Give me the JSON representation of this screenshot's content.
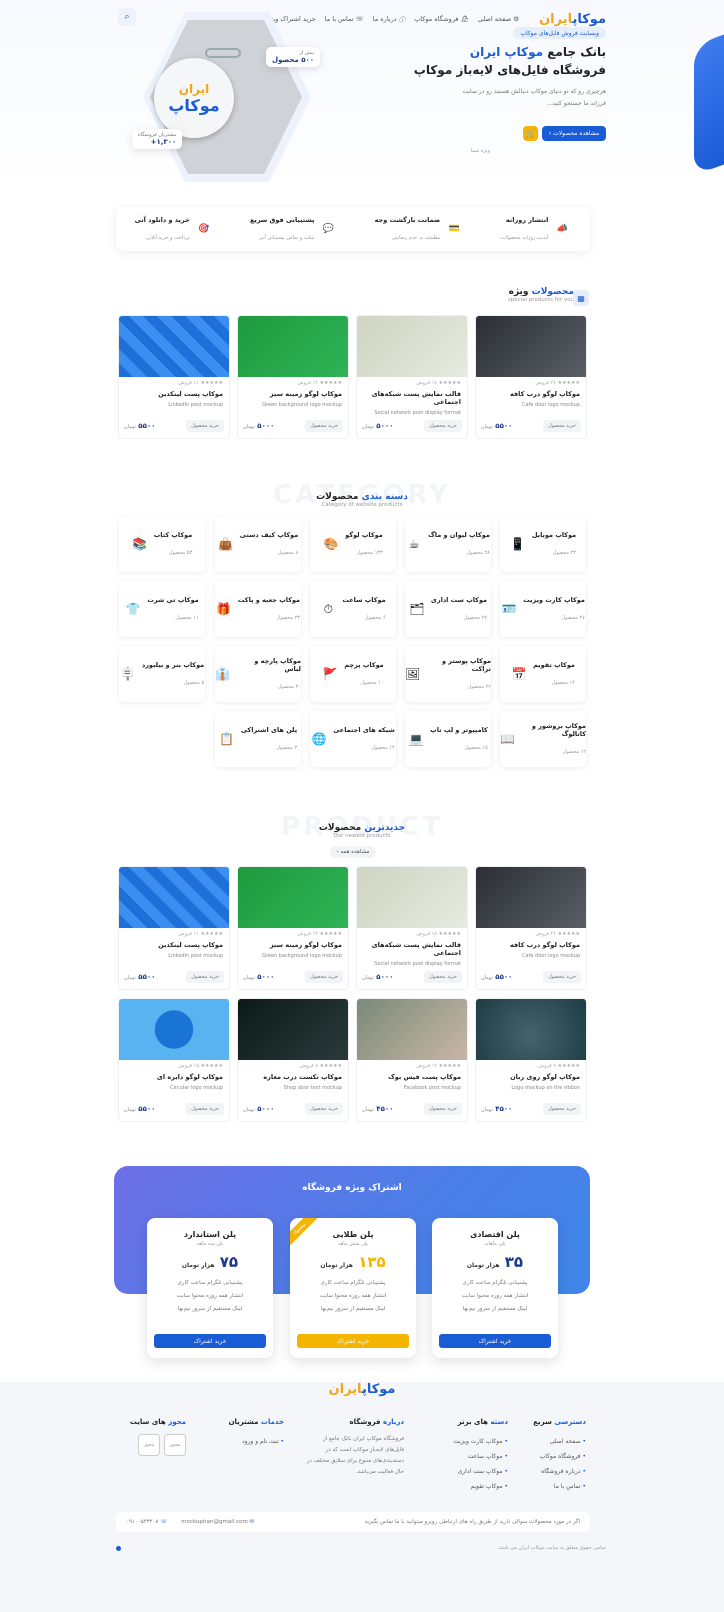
{
  "header": {
    "logo_main": "موکاپ",
    "logo_accent": "ایران",
    "nav": [
      "صفحه اصلی",
      "فروشگاه موکاپ",
      "درباره ما",
      "تماس با ما",
      "خرید اشتراک ویژه"
    ]
  },
  "hero": {
    "tag": "وبسایت فروش فایل‌های موکاپ",
    "title_line1_prefix": "بانک جامع",
    "title_line1_brand": "موکاپ ایران",
    "title_line2": "فروشگاه فایل‌های لایه‌باز موکاپ",
    "desc": "هرچیزی رو که تو دنیای موکاپ دنبالش هستید رو در سایت فرزاند ما جستجو کنید...",
    "cta": "مشاهده محصولات",
    "note": "ویژه شما",
    "stat1_label": "بیش از",
    "stat1_value": "۵۰۰ محصول",
    "stat2_label": "مشتریان فروشگاه",
    "stat2_value": "۱,۳۰۰+",
    "badge_top": "ایران",
    "badge_main": "موکاپ"
  },
  "features": [
    {
      "title": "انتشار روزانه",
      "sub": "آپدیت روزانه محصولات",
      "icon": "megaphone-icon",
      "glyph": "📣"
    },
    {
      "title": "ضمانت بازگشت وجه",
      "sub": "مطمئنه به عدم رضایتی",
      "icon": "card-icon",
      "glyph": "💳"
    },
    {
      "title": "پشتیبانی فوق سریع",
      "sub": "تیکت و تماس پشتیبانی آنی",
      "icon": "chat-icon",
      "glyph": "💬"
    },
    {
      "title": "خرید و دانلود آنی",
      "sub": "پرداخت و خرید آنلاین",
      "icon": "target-icon",
      "glyph": "🎯"
    }
  ],
  "special": {
    "title_a": "محصولات",
    "title_b": "ویژه",
    "sub": "special products for you",
    "products": [
      {
        "name": "موکاپ لوگو درب کافه",
        "en": "Cafe door logo mockup",
        "price": "۵۵۰۰",
        "rating": "★★★★★ ۲۶ فروش"
      },
      {
        "name": "قالب نمایش پست شبکه‌های اجتماعی",
        "en": "Social network post display format",
        "price": "۵۰۰۰",
        "rating": "★★★★★ ۱۸ فروش"
      },
      {
        "name": "موکاپ لوگو زمینه سبز",
        "en": "Green background logo mockup",
        "price": "۵۰۰۰",
        "rating": "★★★★★ ۱۴ فروش"
      },
      {
        "name": "موکاپ پست لینکدین",
        "en": "LinkedIn post mockup",
        "price": "۵۵۰۰",
        "rating": "★★★★★ ۱۱ فروش"
      }
    ]
  },
  "category": {
    "ghost": "CATEGORY",
    "title_a": "دسته بندی",
    "title_b": "محصولات",
    "sub": "Category of website products",
    "items": [
      {
        "name": "موکاپ موبایل",
        "count": "۳۴ محصول",
        "glyph": "📱",
        "icon": "mobile-icon"
      },
      {
        "name": "موکاپ لیوان و ماگ",
        "count": "۲۸ محصول",
        "glyph": "☕",
        "icon": "mug-icon"
      },
      {
        "name": "موکاپ لوگو",
        "count": "۱۳۳ محصول",
        "glyph": "🎨",
        "icon": "logo-icon"
      },
      {
        "name": "موکاپ کیف دستی",
        "count": "۸ محصول",
        "glyph": "👜",
        "icon": "bag-icon"
      },
      {
        "name": "موکاپ کتاب",
        "count": "۵۳ محصول",
        "glyph": "📚",
        "icon": "book-icon"
      },
      {
        "name": "موکاپ کارت ویزیت",
        "count": "۴۷ محصول",
        "glyph": "🪪",
        "icon": "card-icon"
      },
      {
        "name": "موکاپ ست اداری",
        "count": "۲۷ محصول",
        "glyph": "🗂",
        "icon": "office-icon"
      },
      {
        "name": "موکاپ ساعت",
        "count": "۶ محصول",
        "glyph": "⏱",
        "icon": "clock-icon"
      },
      {
        "name": "موکاپ جعبه و پاکت",
        "count": "۳۳ محصول",
        "glyph": "🎁",
        "icon": "box-icon"
      },
      {
        "name": "موکاپ تی شرت",
        "count": "۱۱ محصول",
        "glyph": "👕",
        "icon": "tshirt-icon"
      },
      {
        "name": "موکاپ تقویم",
        "count": "۱۴ محصول",
        "glyph": "📅",
        "icon": "calendar-icon"
      },
      {
        "name": "موکاپ پوستر و تراکت",
        "count": "۲۲ محصول",
        "glyph": "🖼",
        "icon": "poster-icon"
      },
      {
        "name": "موکاپ پرچم",
        "count": "۱۰ محصول",
        "glyph": "🚩",
        "icon": "flag-icon"
      },
      {
        "name": "موکاپ پارچه و لباس",
        "count": "۳۰ محصول",
        "glyph": "👔",
        "icon": "cloth-icon"
      },
      {
        "name": "موکاپ بنر و بیلبورد",
        "count": "۵ محصول",
        "glyph": "🪧",
        "icon": "billboard-icon"
      },
      {
        "name": "موکاپ بروشور و کاتالوگ",
        "count": "۱۲ محصول",
        "glyph": "📖",
        "icon": "brochure-icon"
      },
      {
        "name": "کامپیوتر و لپ تاپ",
        "count": "۱۵ محصول",
        "glyph": "💻",
        "icon": "laptop-icon"
      },
      {
        "name": "شبکه های اجتماعی",
        "count": "۱۴ محصول",
        "glyph": "🌐",
        "icon": "social-icon"
      },
      {
        "name": "پلن های اشتراکی",
        "count": "۳ محصول",
        "glyph": "📋",
        "icon": "plan-icon"
      }
    ]
  },
  "newest": {
    "ghost": "PRODUCT",
    "title_a": "جدیدترین",
    "title_b": "محصولات",
    "sub": "Our newest products",
    "view_all": "مشاهده همه",
    "buy": "خرید محصول",
    "currency": "تومان",
    "products": [
      {
        "name": "موکاپ لوگو درب کافه",
        "en": "Cafe door logo mockup",
        "price": "۵۵۰۰",
        "rating": "★★★★★ ۲۶ فروش"
      },
      {
        "name": "قالب نمایش پست شبکه‌های اجتماعی",
        "en": "Social network post display format",
        "price": "۵۰۰۰",
        "rating": "★★★★★ ۱۸ فروش"
      },
      {
        "name": "موکاپ لوگو زمینه سبز",
        "en": "Green background logo mockup",
        "price": "۵۰۰۰",
        "rating": "★★★★★ ۱۴ فروش"
      },
      {
        "name": "موکاپ پست لینکدین",
        "en": "LinkedIn post mockup",
        "price": "۵۵۰۰",
        "rating": "★★★★★ ۱۱ فروش"
      },
      {
        "name": "موکاپ لوگو روی ربان",
        "en": "Logo mockup on the ribbon",
        "price": "۴۵۰۰",
        "rating": "★★★★★ ۹ فروش"
      },
      {
        "name": "موکاپ پست فیس بوک",
        "en": "Facebook post mockup",
        "price": "۴۵۰۰",
        "rating": "★★★★★ ۱۲ فروش"
      },
      {
        "name": "موکاپ تکست درب مغازه",
        "en": "Shop door text mockup",
        "price": "۵۰۰۰",
        "rating": "★★★★★ ۸ فروش"
      },
      {
        "name": "موکاپ لوگو دایره ای",
        "en": "Circular logo mockup",
        "price": "۵۵۰۰",
        "rating": "★★★★★ ۱۵ فروش"
      }
    ]
  },
  "subscription": {
    "title_a": "اشتراک",
    "title_b": "ویژه فروشگاه",
    "plans": [
      {
        "name": "پلن اقتصادی",
        "period": "پلن ماهانه",
        "price": "۳۵",
        "unit": "هزار تومان",
        "f1": "پشتیبانی تلگرام ساعت کاری",
        "f2": "انتشار همه روزه محتوا سایت",
        "f3": "لینک مستقیم از سرور ‌نیم‌بها",
        "btn": "خرید اشتراک"
      },
      {
        "name": "پلن طلایی",
        "period": "پلن شش ماهه",
        "price": "۱۳۵",
        "unit": "هزار تومان",
        "f1": "پشتیبانی تلگرام ساعت کاری",
        "f2": "انتشار همه روزه محتوا سایت",
        "f3": "لینک مستقیم از سرور نیم‌بها",
        "btn": "خرید اشتراک",
        "ribbon": "پیشنهاد"
      },
      {
        "name": "پلن استاندارد",
        "period": "پلن سه ماهه",
        "price": "۷۵",
        "unit": "هزار تومان",
        "f1": "پشتیبانی تلگرام ساعت کاری",
        "f2": "انتشار همه روزه محتوا سایت",
        "f3": "لینک مستقیم از سرور نیم‌بها",
        "btn": "خرید اشتراک"
      }
    ]
  },
  "footer": {
    "col1_a": "دسترسی",
    "col1_b": "سریع",
    "col1": [
      "صفحه اصلی",
      "فروشگاه موکاپ",
      "درباره فروشگاه",
      "تماس با ما"
    ],
    "col2_a": "دسته",
    "col2_b": "های برتر",
    "col2": [
      "موکاپ کارت ویزیت",
      "موکاپ ساعت",
      "موکاپ ست اداری",
      "موکاپ تقویم"
    ],
    "col3_a": "درباره",
    "col3_b": "فروشگاه",
    "col3_text": "فروشگاه موکاپ ایران بانک جامع از فایل‌های لایه‌باز موکاپ است که در دسته‌بندی‌های متنوع برای سلایق مختلف در حال فعالیت می‌باشد.",
    "col4_a": "خدمات",
    "col4_b": "مشتریان",
    "col4": [
      "ثبت نام و ورود"
    ],
    "col5_a": "مجوز",
    "col5_b": "های سایت",
    "license": "مجوز",
    "contact_note": "اگر در مورد محصولات سوالی دارید از طریق راه های ارتباطی روبرو میتوانید با ما تماس بگیرید",
    "email": "mockupiran@gmail.com",
    "phone": "۰۹۱۰۰۵۴۳۲۰۸",
    "copyright": "تمامی حقوق متعلق به سایت موکاپ ایران می باشد."
  },
  "colors": {
    "primary": "#1a5bd6",
    "accent": "#f5b400",
    "dark": "#1a3a8a"
  }
}
